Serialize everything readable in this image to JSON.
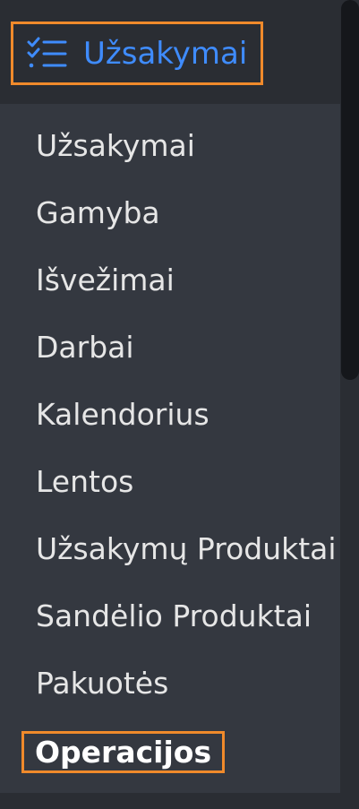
{
  "header": {
    "icon": "checklist-icon",
    "label": "Užsakymai",
    "accent": "#3f8cff",
    "highlight": "#f08a2b"
  },
  "menu": {
    "items": [
      {
        "label": "Užsakymai"
      },
      {
        "label": "Gamyba"
      },
      {
        "label": "Išvežimai"
      },
      {
        "label": "Darbai"
      },
      {
        "label": "Kalendorius"
      },
      {
        "label": "Lentos"
      },
      {
        "label": "Užsakymų Produktai"
      },
      {
        "label": "Sandėlio Produktai"
      },
      {
        "label": "Pakuotės"
      },
      {
        "label": "Operacijos",
        "active": true
      }
    ]
  }
}
